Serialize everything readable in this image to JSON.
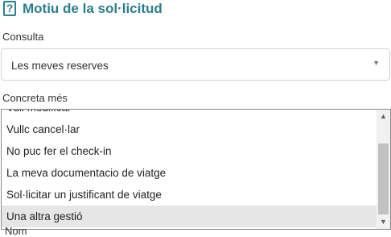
{
  "header": {
    "icon": "question-mark-icon",
    "icon_glyph": "?",
    "title": "Motiu de la sol·licitud"
  },
  "consulta": {
    "label": "Consulta",
    "selected_value": "Les meves reserves",
    "arrow_glyph": "▼"
  },
  "concreta": {
    "label": "Concreta més",
    "options": [
      {
        "label": "Vull modificar",
        "selected": false
      },
      {
        "label": "Vullc cancel·lar",
        "selected": false
      },
      {
        "label": "No puc fer el check-in",
        "selected": false
      },
      {
        "label": "La meva documentacio de viatge",
        "selected": false
      },
      {
        "label": "Sol·licitar un justificant de viatge",
        "selected": false
      },
      {
        "label": "Una altra gestió",
        "selected": true
      }
    ],
    "scroll_up_glyph": "▲",
    "scroll_down_glyph": "▼"
  },
  "below_cut_text": "Nom"
}
